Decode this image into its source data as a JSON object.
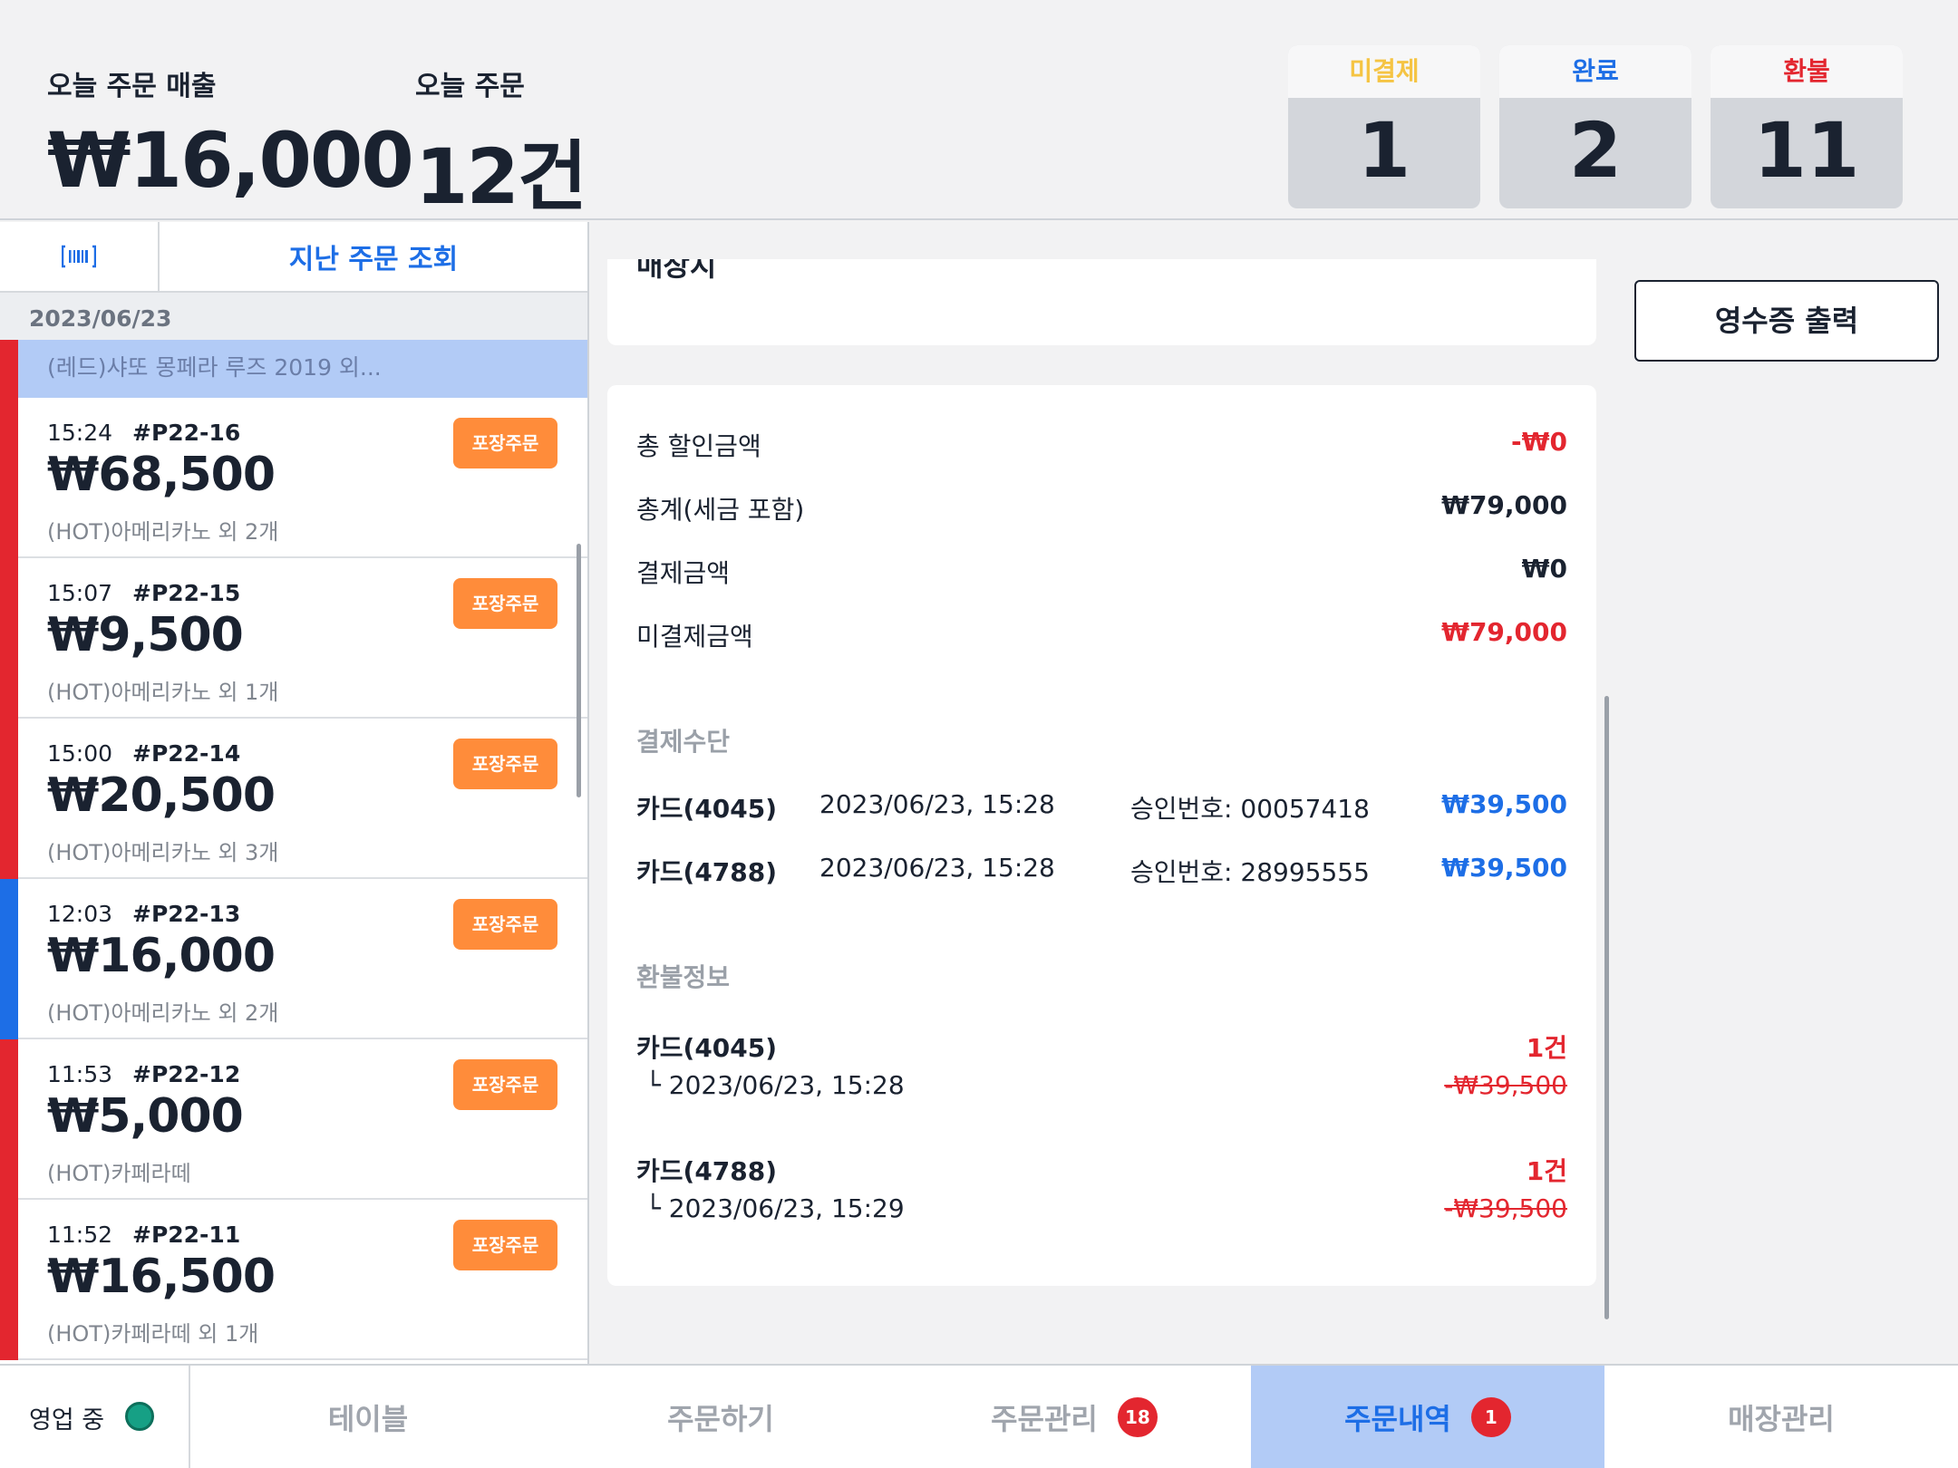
{
  "header": {
    "sales_label": "오늘 주문 매출",
    "sales_value": "₩16,000",
    "count_label": "오늘 주문",
    "count_value": "12건",
    "status_counts": [
      {
        "label": "미결제",
        "value": "1",
        "color": "#f5c443"
      },
      {
        "label": "완료",
        "value": "2",
        "color": "#1d6ee6"
      },
      {
        "label": "환불",
        "value": "11",
        "color": "#e3262f"
      }
    ]
  },
  "left_panel": {
    "barcode_icon": "barcode-icon",
    "past_orders_label": "지난 주문 조회",
    "date": "2023/06/23",
    "selected_item": "(레드)샤또 몽페라 루즈 2019 외...",
    "orders": [
      {
        "time": "15:24",
        "number": "#P22-16",
        "amount": "₩68,500",
        "desc": "(HOT)아메리카노 외 2개",
        "badge": "포장주문",
        "status_color": "#e3262f"
      },
      {
        "time": "15:07",
        "number": "#P22-15",
        "amount": "₩9,500",
        "desc": "(HOT)아메리카노 외 1개",
        "badge": "포장주문",
        "status_color": "#e3262f"
      },
      {
        "time": "15:00",
        "number": "#P22-14",
        "amount": "₩20,500",
        "desc": "(HOT)아메리카노 외 3개",
        "badge": "포장주문",
        "status_color": "#e3262f"
      },
      {
        "time": "12:03",
        "number": "#P22-13",
        "amount": "₩16,000",
        "desc": "(HOT)아메리카노 외 2개",
        "badge": "포장주문",
        "status_color": "#1d6ee6"
      },
      {
        "time": "11:53",
        "number": "#P22-12",
        "amount": "₩5,000",
        "desc": "(HOT)카페라떼",
        "badge": "포장주문",
        "status_color": "#e3262f"
      },
      {
        "time": "11:52",
        "number": "#P22-11",
        "amount": "₩16,500",
        "desc": "(HOT)카페라떼 외 1개",
        "badge": "포장주문",
        "status_color": "#e3262f"
      }
    ]
  },
  "detail": {
    "top_partial_label": "매장지",
    "summary": [
      {
        "label": "총 할인금액",
        "value": "-₩0",
        "color": "#e3262f"
      },
      {
        "label": "총계(세금 포함)",
        "value": "₩79,000",
        "color": "#1a2230"
      },
      {
        "label": "결제금액",
        "value": "₩0",
        "color": "#1a2230"
      },
      {
        "label": "미결제금액",
        "value": "₩79,000",
        "color": "#e3262f"
      }
    ],
    "payment_title": "결제수단",
    "payments": [
      {
        "method": "카드(4045)",
        "datetime": "2023/06/23, 15:28",
        "approval": "승인번호: 00057418",
        "amount": "₩39,500"
      },
      {
        "method": "카드(4788)",
        "datetime": "2023/06/23, 15:28",
        "approval": "승인번호: 28995555",
        "amount": "₩39,500"
      }
    ],
    "refund_title": "환불정보",
    "refunds": [
      {
        "method": "카드(4045)",
        "datetime": "└ 2023/06/23, 15:28",
        "count": "1건",
        "amount": "-₩39,500"
      },
      {
        "method": "카드(4788)",
        "datetime": "└ 2023/06/23, 15:29",
        "count": "1건",
        "amount": "-₩39,500"
      }
    ]
  },
  "right_panel": {
    "receipt_button": "영수증 출력"
  },
  "nav": {
    "status_label": "영업 중",
    "tabs": [
      {
        "label": "테이블",
        "badge": ""
      },
      {
        "label": "주문하기",
        "badge": ""
      },
      {
        "label": "주문관리",
        "badge": "18"
      },
      {
        "label": "주문내역",
        "badge": "1"
      },
      {
        "label": "매장관리",
        "badge": ""
      }
    ]
  }
}
